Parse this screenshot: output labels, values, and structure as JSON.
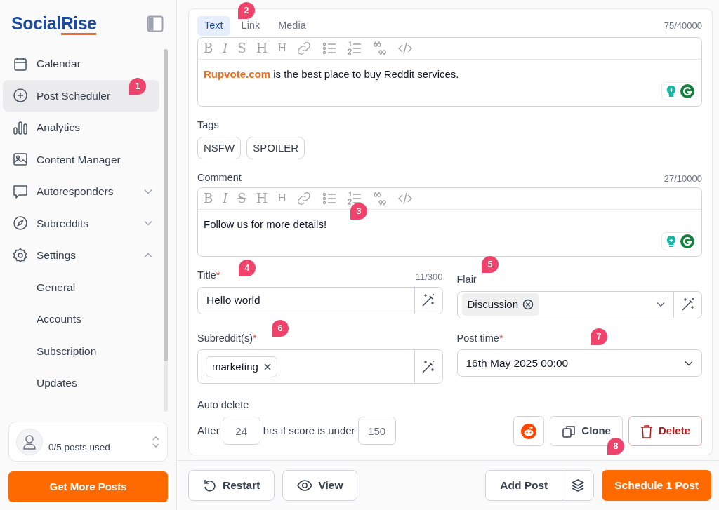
{
  "brand": {
    "part1": "Social",
    "part2": "Rise"
  },
  "sidebar": {
    "items": [
      {
        "label": "Calendar",
        "selected": false
      },
      {
        "label": "Post Scheduler",
        "selected": true
      },
      {
        "label": "Analytics",
        "selected": false
      },
      {
        "label": "Content Manager",
        "selected": false
      },
      {
        "label": "Autoresponders",
        "selected": false,
        "expanded": false
      },
      {
        "label": "Subreddits",
        "selected": false,
        "expanded": false
      },
      {
        "label": "Settings",
        "selected": false,
        "expanded": true,
        "children": [
          {
            "label": "General",
            "selected": false
          },
          {
            "label": "Accounts",
            "selected": false
          },
          {
            "label": "Subscription",
            "selected": false
          },
          {
            "label": "Updates",
            "selected": false
          }
        ]
      }
    ],
    "usage": "0/5 posts used",
    "cta": "Get More Posts"
  },
  "editor": {
    "tabs": [
      {
        "label": "Text",
        "selected": true
      },
      {
        "label": "Link",
        "selected": false
      },
      {
        "label": "Media",
        "selected": false
      }
    ],
    "counter": "75/40000",
    "toolbar": [
      "B",
      "I",
      "S",
      "H",
      "H"
    ],
    "link": "Rupvote.com",
    "text": " is the best place to buy Reddit services."
  },
  "tags": {
    "label": "Tags",
    "items": [
      "NSFW",
      "SPOILER"
    ]
  },
  "comment": {
    "label": "Comment",
    "counter": "27/10000",
    "toolbar": [
      "B",
      "I",
      "S",
      "H",
      "H"
    ],
    "text": "Follow us for more details!"
  },
  "title_field": {
    "label": "Title",
    "required_mark": "*",
    "counter": "11/300",
    "value": "Hello world"
  },
  "flair": {
    "label": "Flair",
    "chip": "Discussion"
  },
  "subreddits": {
    "label": "Subreddit(s)",
    "required_mark": "*",
    "chips": [
      "marketing"
    ]
  },
  "post_time": {
    "label": "Post time",
    "required_mark": "*",
    "value": "16th May 2025 00:00"
  },
  "auto_delete": {
    "label": "Auto delete",
    "prefix": "After",
    "hours": "24",
    "middle": "hrs if score is under",
    "score": "150"
  },
  "actions": {
    "clone": "Clone",
    "delete": "Delete"
  },
  "footer": {
    "restart": "Restart",
    "view": "View",
    "add": "Add Post",
    "schedule": "Schedule 1 Post"
  },
  "callouts": [
    "1",
    "2",
    "3",
    "4",
    "5",
    "6",
    "7",
    "8"
  ]
}
